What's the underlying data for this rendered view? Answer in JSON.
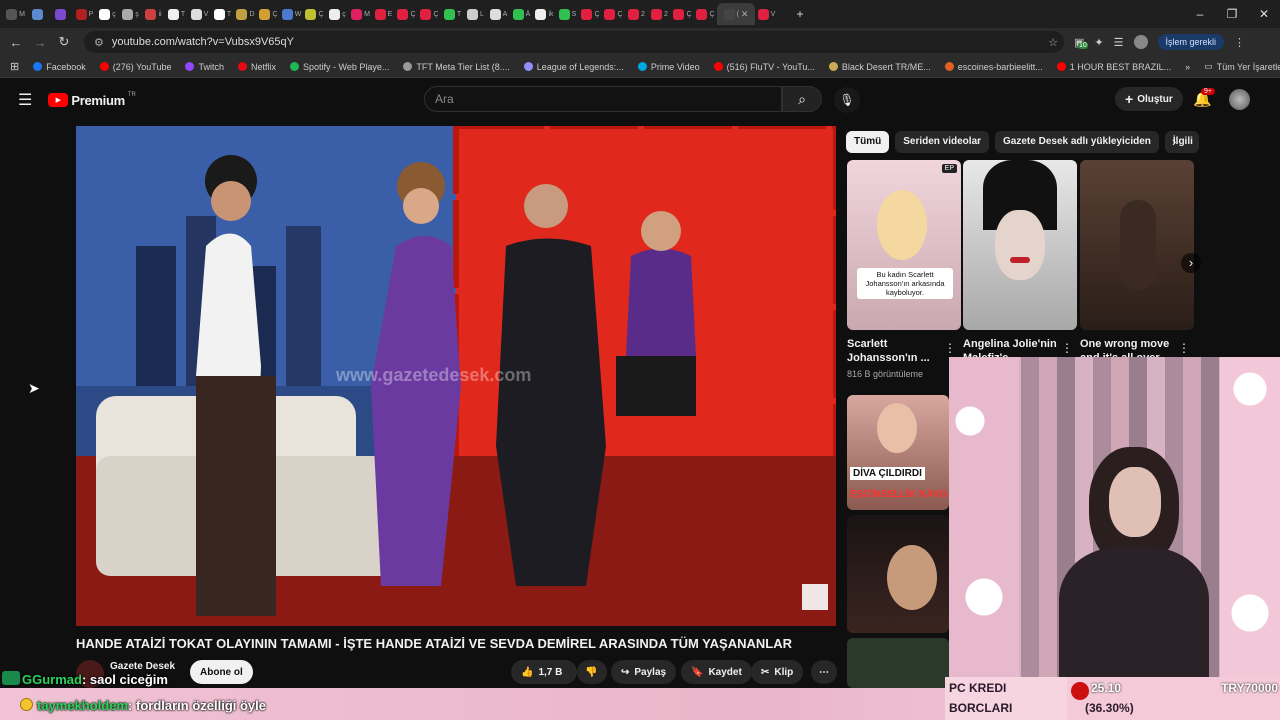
{
  "browser": {
    "tabs": [
      "M",
      "",
      "",
      "P",
      "ç",
      "ş",
      "ii",
      "T",
      "V",
      "T",
      "D",
      "Ç",
      "W",
      "Ç",
      "ç",
      "M",
      "E",
      "Ç",
      "Ç",
      "T",
      "L",
      "A",
      "Ä",
      "ik",
      "S",
      "Ç",
      "Ç",
      "2",
      "2",
      "Ç",
      "Ç",
      "(",
      "V"
    ],
    "active_tab_close": "✕",
    "new_tab": "+",
    "window_controls": [
      "–",
      "❐",
      "✕"
    ],
    "url": "youtube.com/watch?v=Vubsx9V65qY",
    "profile_label": "İşlem gerekli",
    "extension_badge": "10",
    "bookmarks": [
      {
        "label": "Facebook",
        "color": "#1877f2"
      },
      {
        "label": "(276) YouTube",
        "color": "#ff0000"
      },
      {
        "label": "Twitch",
        "color": "#9146ff"
      },
      {
        "label": "Netflix",
        "color": "#e50914"
      },
      {
        "label": "Spotify - Web Playe...",
        "color": "#1db954"
      },
      {
        "label": "TFT Meta Tier List (8....",
        "color": "#999999"
      },
      {
        "label": "League of Legends:...",
        "color": "#8f8fff"
      },
      {
        "label": "Prime Video",
        "color": "#00a8e1"
      },
      {
        "label": "(516) FluTV - YouTu...",
        "color": "#ff0000"
      },
      {
        "label": "Black Desert TR/ME...",
        "color": "#ccaa55"
      },
      {
        "label": "escoines-barbieelitt...",
        "color": "#e06020"
      },
      {
        "label": "1 HOUR BEST BRAZIL...",
        "color": "#ff0000"
      }
    ],
    "bookmarks_more": "»",
    "all_bookmarks": "Tüm Yer İşaretleri"
  },
  "youtube": {
    "logo": "Premium",
    "logo_region": "TR",
    "search_placeholder": "Ara",
    "create_label": "Oluştur",
    "notif_badge": "9+",
    "chips": [
      "Tümü",
      "Seriden videolar",
      "Gazete Desek adlı yükleyiciden",
      "İlgili"
    ],
    "shorts": [
      {
        "title": "Scarlett Johansson'ın ...",
        "views": "816 B görüntüleme",
        "caption": "Bu kadın Scarlett Johansson'ın arkasında kayboluyor.",
        "corner": "EP"
      },
      {
        "title": "Angelina Jolie'nin Malefiz'e ...",
        "views": ""
      },
      {
        "title": "One wrong move and it's all over ...",
        "views": ""
      }
    ],
    "side_thumbs": [
      {
        "caption1": "DİVA ÇILDIRDI",
        "caption2": "EŞCİNSELLİK KAVG"
      }
    ],
    "video_watermark": "www.gazetedesek.com",
    "video_title": "HANDE ATAİZİ TOKAT OLAYININ TAMAMI - İŞTE HANDE ATAİZİ VE SEVDA DEMİREL ARASINDA TÜM YAŞANANLAR",
    "channel": "Gazete Desek",
    "subscribe": "Abone ol",
    "likes": "1,7 B",
    "share": "Paylaş",
    "save": "Kaydet",
    "clip": "Klip",
    "more": "⋯"
  },
  "stream_overlay": {
    "chat": [
      {
        "user": "GGurmad",
        "text": ": saol ciceğim",
        "color": "#2bd45a"
      },
      {
        "user": "taymekholdem",
        "text": ": fordların özelliği öyle",
        "color": "#2bd45a"
      }
    ],
    "widget_label1": "PC KREDI",
    "widget_label2": "BORCLARI",
    "widget_value": "(36.30%)",
    "widget_amount": "25.10",
    "widget_code": "TRY70000"
  },
  "colors": {
    "accent": "#ff0000",
    "chat_user": "#2bd45a",
    "overlay_pink": "#f0c2d4"
  }
}
